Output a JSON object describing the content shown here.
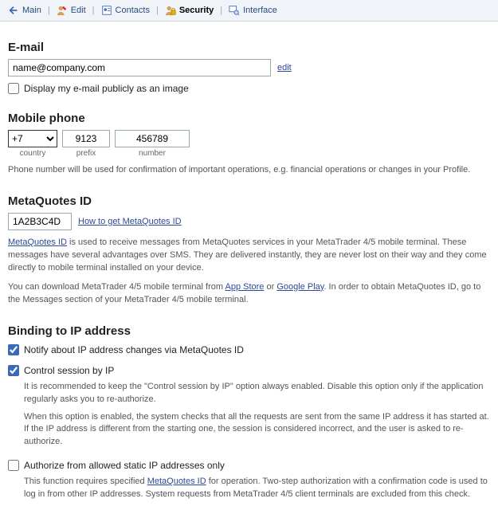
{
  "tabs": {
    "main": "Main",
    "edit": "Edit",
    "contacts": "Contacts",
    "security": "Security",
    "interface": "Interface"
  },
  "email": {
    "heading": "E-mail",
    "value": "name@company.com",
    "edit_link": "edit",
    "display_public_label": "Display my e-mail publicly as an image"
  },
  "phone": {
    "heading": "Mobile phone",
    "country_code": "+7",
    "prefix": "9123",
    "number": "456789",
    "country_label": "country",
    "prefix_label": "prefix",
    "number_label": "number",
    "help": "Phone number will be used for confirmation of important operations, e.g. financial operations or changes in your Profile."
  },
  "mq": {
    "heading": "MetaQuotes ID",
    "value": "1A2B3C4D",
    "howto_link": "How to get MetaQuotes ID",
    "para1_pre": "",
    "link_mqid": "MetaQuotes ID",
    "para1_post": " is used to receive messages from MetaQuotes services in your MetaTrader 4/5 mobile terminal. These messages have several advantages over SMS. They are delivered instantly, they are never lost on their way and they come directly to mobile terminal installed on your device.",
    "para2_pre": "You can download MetaTrader 4/5 mobile terminal from ",
    "link_appstore": "App Store",
    "para2_or": " or ",
    "link_googleplay": "Google Play",
    "para2_post": ". In order to obtain MetaQuotes ID, go to the Messages section of your MetaTrader 4/5 mobile terminal."
  },
  "ip": {
    "heading": "Binding to IP address",
    "notify_label": "Notify about IP address changes via MetaQuotes ID",
    "control_label": "Control session by IP",
    "control_help1": "It is recommended to keep the \"Control session by IP\" option always enabled. Disable this option only if the application regularly asks you to re-authorize.",
    "control_help2": "When this option is enabled, the system checks that all the requests are sent from the same IP address it has started at. If the IP address is different from the starting one, the session is considered incorrect, and the user is asked to re-authorize.",
    "static_label": "Authorize from allowed static IP addresses only",
    "static_help_pre": "This function requires specified ",
    "static_help_link": "MetaQuotes ID",
    "static_help_post": " for operation. Two-step authorization with a confirmation code is used to log in from other IP addresses. System requests from MetaTrader 4/5 client terminals are excluded from this check."
  }
}
